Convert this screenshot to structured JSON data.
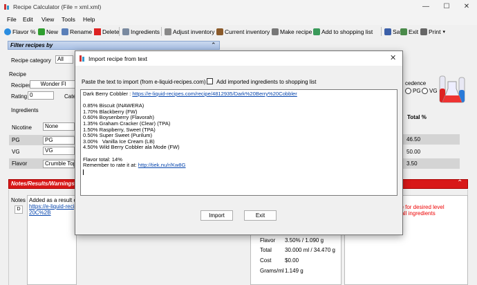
{
  "window": {
    "title": "Recipe Calculator (File = xml.xml)",
    "minimize": "—",
    "maximize": "☐",
    "close": "✕"
  },
  "menu": [
    "File",
    "Edit",
    "View",
    "Tools",
    "Help"
  ],
  "toolbar": {
    "flavor": "Flavor %",
    "new": "New",
    "rename": "Rename",
    "delete": "Delete",
    "ingredients": "Ingredients",
    "adjust": "Adjust inventory",
    "current": "Current inventory",
    "make": "Make recipe",
    "shopping": "Add to shopping list",
    "save": "Save",
    "exit": "Exit",
    "print": "Print"
  },
  "filter_panel": {
    "title": "Filter recipes by",
    "category_label": "Recipe category",
    "category_value": "All"
  },
  "recipe_panel": {
    "title": "Recipe",
    "recipes_label": "Recipes",
    "recipes_value": "Wonder Fl",
    "rating_label": "Rating",
    "rating_value": "0",
    "category_label": "Categ",
    "precedence_label": "cedence",
    "pg_label": "PG",
    "vg_label": "VG"
  },
  "ingredients_panel": {
    "title": "Ingredients",
    "total_header": "Total %",
    "rows": [
      {
        "name": "Nicotine",
        "value": "None",
        "total": ""
      },
      {
        "name": "PG",
        "value": "PG",
        "total": "46.50"
      },
      {
        "name": "VG",
        "value": "VG",
        "total": "50.00"
      },
      {
        "name": "Flavor",
        "value": "Crumble Topp",
        "total": "3.50"
      }
    ]
  },
  "notes_panel": {
    "title": "Notes/Results/Warnings",
    "notes_label": "Notes",
    "d_button": "D",
    "notes_line1": "Added as a result of a",
    "notes_link1": "https://e-liquid-recipe",
    "notes_link2": "20C%2B",
    "warning1": "tine for desired level",
    "warning2": "or all ingredients"
  },
  "results": [
    {
      "label": "Flavor",
      "value": "3.50% / 1.090 g"
    },
    {
      "label": "Total",
      "value": "30.000 ml / 34.470 g"
    },
    {
      "label": "Cost",
      "value": "$0.00"
    },
    {
      "label": "Grams/ml",
      "value": "1.149 g"
    }
  ],
  "dialog": {
    "title": "Import recipe from text",
    "close": "✕",
    "instruction": "Paste the text to import (from e-liquid-recipes.com)",
    "checkbox_label": "Add imported ingredients to shopping list",
    "text_lines": [
      {
        "text": "Dark Berry Cobbler : ",
        "link": "https://e-liquid-recipes.com/recipe/4812935/Dark%20Berry%20Cobbler"
      },
      {
        "text": ""
      },
      {
        "text": "0.85% Biscuit (INAWERA)"
      },
      {
        "text": "1.70% Blackberry (FW)"
      },
      {
        "text": "0.60% Boysenberry (Flavorah)"
      },
      {
        "text": "1.35% Graham Cracker (Clear) (TPA)"
      },
      {
        "text": "1.50% Raspberry, Sweet (TPA)"
      },
      {
        "text": "0.50% Super Sweet (Purilum)"
      },
      {
        "text": "3.00%   Vanilla Ice Cream (LB)"
      },
      {
        "text": "4.50% Wild Berry Cobbler ala Mode (FW)"
      },
      {
        "text": ""
      },
      {
        "text": "Flavor total: 14%"
      },
      {
        "text": "Remember to rate it at: ",
        "link": "http://tiek.nu/r/Kw8G"
      }
    ],
    "import_button": "Import",
    "exit_button": "Exit"
  },
  "colors": {
    "header_blue": "#b4c8e8",
    "warning_red": "#d81818",
    "link": "#0645ad"
  }
}
